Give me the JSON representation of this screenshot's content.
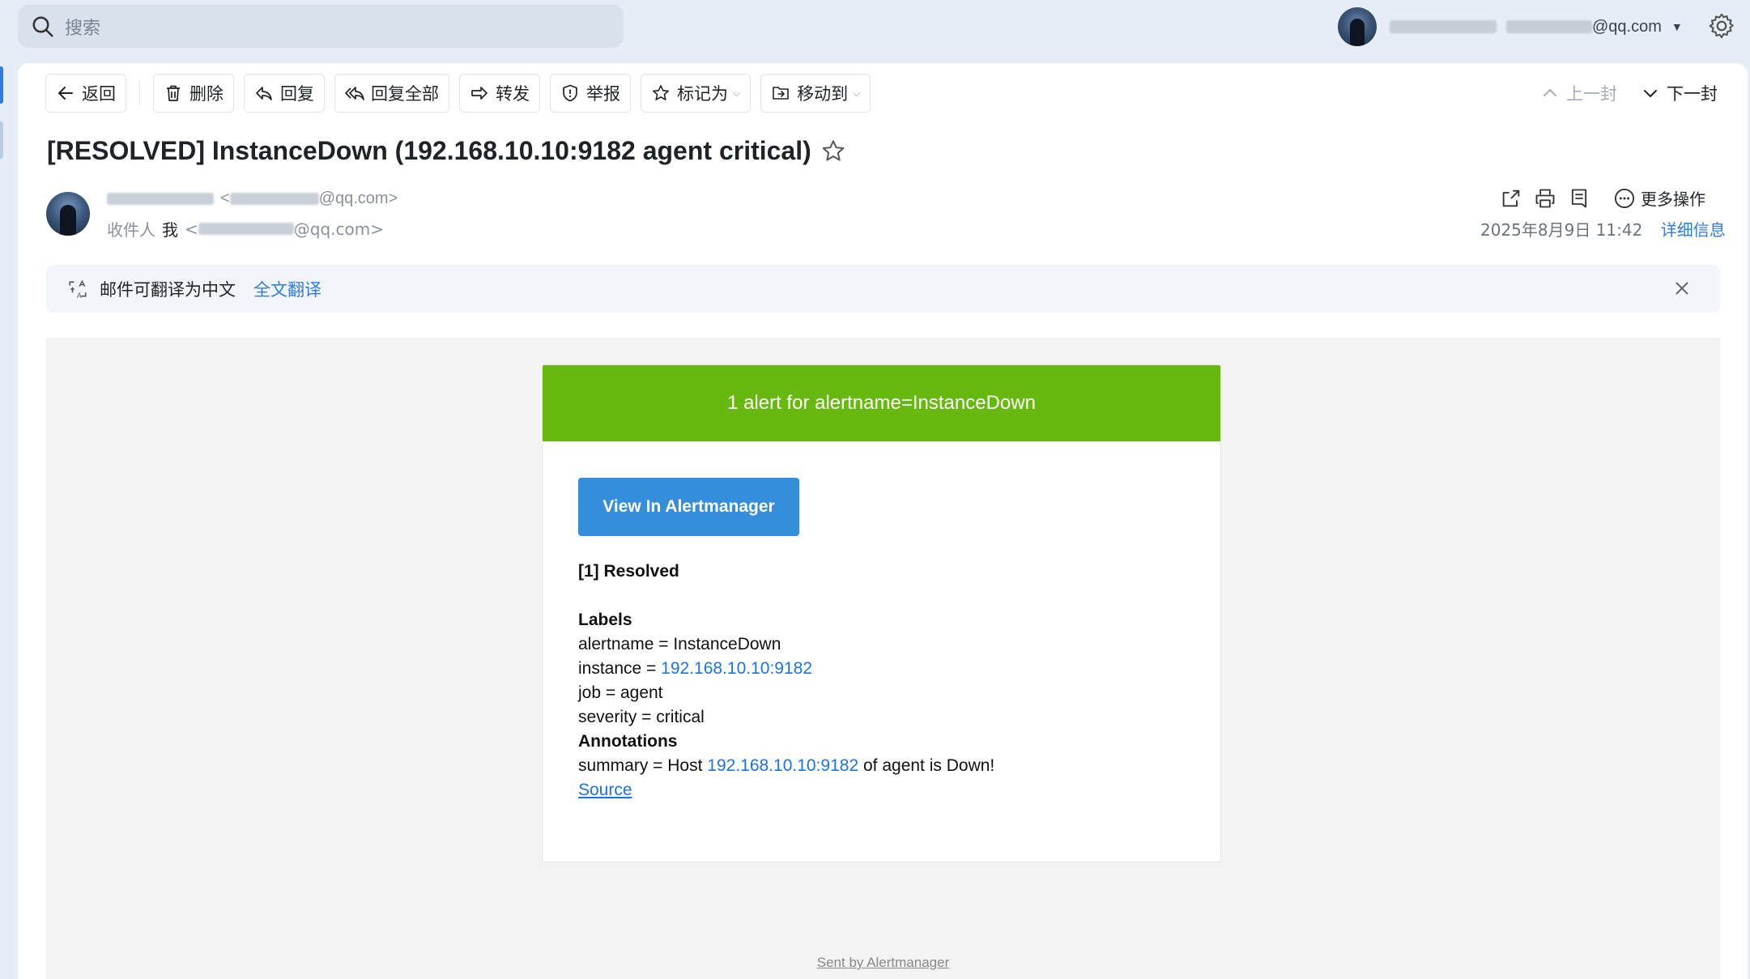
{
  "search": {
    "placeholder": "搜索"
  },
  "account": {
    "email_suffix": "@qq.com"
  },
  "toolbar": {
    "back": "返回",
    "delete": "删除",
    "reply": "回复",
    "reply_all": "回复全部",
    "forward": "转发",
    "report": "举报",
    "mark_as": "标记为",
    "move_to": "移动到"
  },
  "nav": {
    "prev": "上一封",
    "next": "下一封"
  },
  "email": {
    "subject": "[RESOLVED] InstanceDown (192.168.10.10:9182 agent critical)",
    "from_suffix": "@qq.com>",
    "to_label": "收件人",
    "to_me": "我",
    "to_suffix": "@qq.com>",
    "date": "2025年8月9日 11:42",
    "detail_link": "详细信息",
    "more_ops": "更多操作"
  },
  "translate": {
    "text": "邮件可翻译为中文",
    "link": "全文翻译"
  },
  "alert": {
    "header": "1 alert for alertname=InstanceDown",
    "button": "View In Alertmanager",
    "resolved_title": "[1] Resolved",
    "labels_title": "Labels",
    "alertname_line": "alertname = InstanceDown",
    "instance_prefix": "instance = ",
    "instance_value": "192.168.10.10:9182",
    "job_line": "job = agent",
    "severity_line": "severity = critical",
    "annotations_title": "Annotations",
    "summary_prefix": "summary = Host ",
    "summary_host": "192.168.10.10:9182",
    "summary_suffix": " of agent is Down!",
    "source_link": "Source",
    "sent_by": "Sent by Alertmanager"
  },
  "colors": {
    "alert_header_bg": "#68b90f",
    "button_bg": "#348eda",
    "link": "#1a73e8",
    "accent": "#2f7be5"
  }
}
